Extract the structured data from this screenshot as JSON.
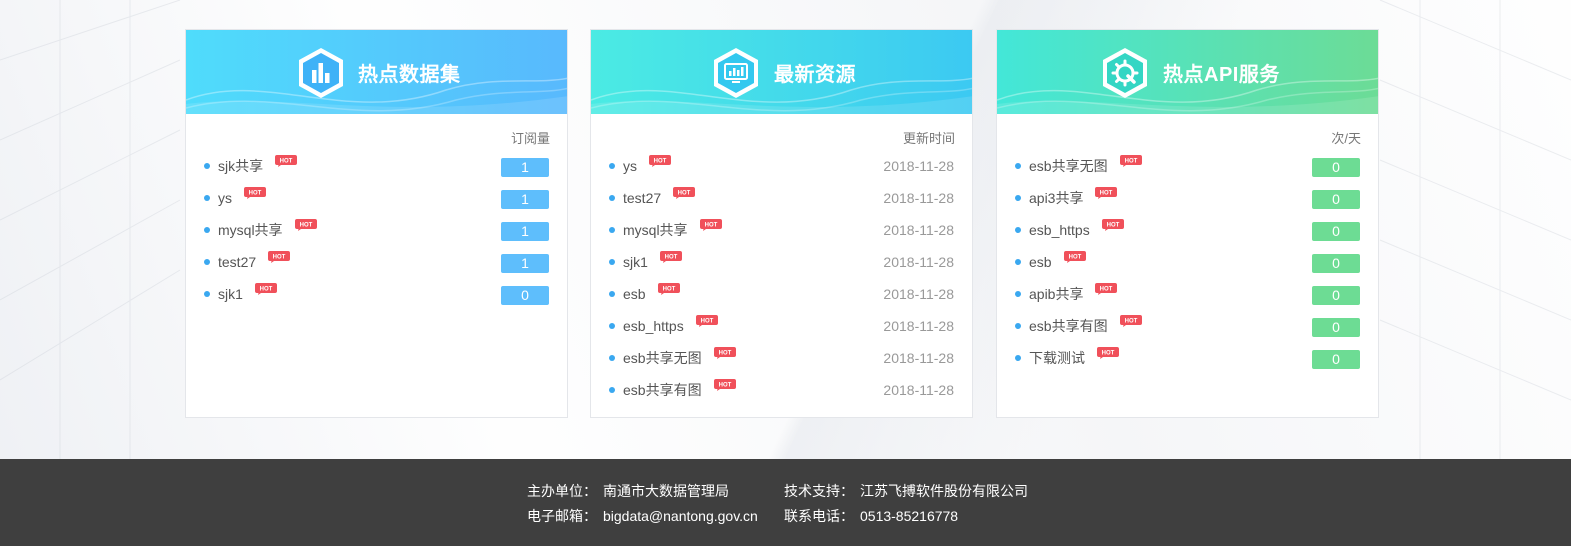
{
  "colors": {
    "blue_badge": "#5ebefc",
    "green_badge": "#6ddc94",
    "hot_red": "#f0505a",
    "footer_bg": "#3f3f3f",
    "dot": "#3aa8f0"
  },
  "hot_label": "HOT",
  "cards": [
    {
      "title": "热点数据集",
      "icon": "bar-chart-icon",
      "column_label": "订阅量",
      "items": [
        {
          "name": "sjk共享",
          "value": "1"
        },
        {
          "name": "ys",
          "value": "1"
        },
        {
          "name": "mysql共享",
          "value": "1"
        },
        {
          "name": "test27",
          "value": "1"
        },
        {
          "name": "sjk1",
          "value": "0"
        }
      ]
    },
    {
      "title": "最新资源",
      "icon": "monitor-chart-icon",
      "column_label": "更新时间",
      "items": [
        {
          "name": "ys",
          "value": "2018-11-28"
        },
        {
          "name": "test27",
          "value": "2018-11-28"
        },
        {
          "name": "mysql共享",
          "value": "2018-11-28"
        },
        {
          "name": "sjk1",
          "value": "2018-11-28"
        },
        {
          "name": "esb",
          "value": "2018-11-28"
        },
        {
          "name": "esb_https",
          "value": "2018-11-28"
        },
        {
          "name": "esb共享无图",
          "value": "2018-11-28"
        },
        {
          "name": "esb共享有图",
          "value": "2018-11-28"
        }
      ]
    },
    {
      "title": "热点API服务",
      "icon": "gear-wrench-icon",
      "column_label": "次/天",
      "items": [
        {
          "name": "esb共享无图",
          "value": "0"
        },
        {
          "name": "api3共享",
          "value": "0"
        },
        {
          "name": "esb_https",
          "value": "0"
        },
        {
          "name": "esb",
          "value": "0"
        },
        {
          "name": "apib共享",
          "value": "0"
        },
        {
          "name": "esb共享有图",
          "value": "0"
        },
        {
          "name": "下载测试",
          "value": "0"
        }
      ]
    }
  ],
  "footer": {
    "host_label": "主办单位：",
    "host_value": "南通市大数据管理局",
    "support_label": "技术支持：",
    "support_value": "江苏飞搏软件股份有限公司",
    "email_label": "电子邮箱：",
    "email_value": "bigdata@nantong.gov.cn",
    "phone_label": "联系电话：",
    "phone_value": "0513-85216778"
  }
}
